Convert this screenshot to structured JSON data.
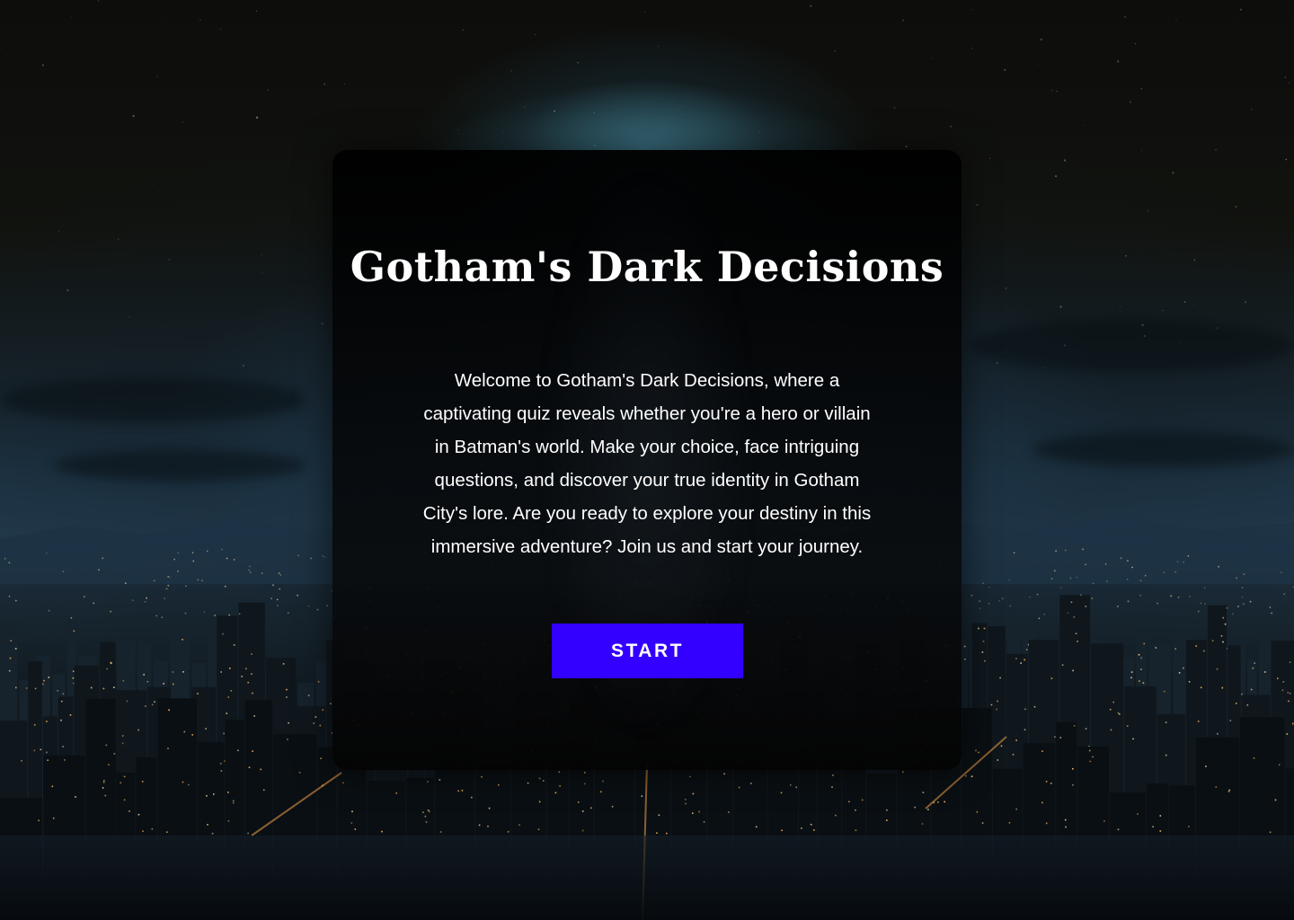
{
  "hero": {
    "title": "Gotham's Dark Decisions",
    "description": "Welcome to Gotham's Dark Decisions, where a captivating quiz reveals whether you're a hero or villain in Batman's world. Make your choice, face intriguing questions, and discover your true identity in Gotham City's lore. Are you ready to explore your destiny in this immersive adventure? Join us and start your journey.",
    "start_label": "START"
  },
  "colors": {
    "accent": "#3300ff",
    "card_background": "#000000",
    "text": "#ffffff"
  }
}
